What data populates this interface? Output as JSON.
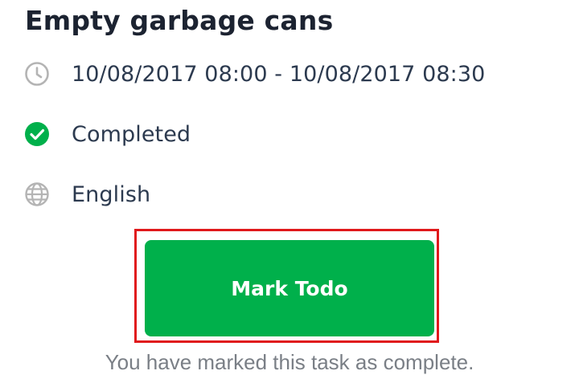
{
  "task": {
    "title": "Empty garbage cans",
    "time_range": "10/08/2017 08:00 - 10/08/2017 08:30",
    "status": "Completed",
    "language": "English"
  },
  "icons": {
    "time": "clock-icon",
    "status": "check-circle-icon",
    "language": "globe-icon"
  },
  "colors": {
    "accent_green": "#00b04b",
    "highlight_red": "#e0191c",
    "icon_grey": "#b4b4b4"
  },
  "action": {
    "button_label": "Mark Todo"
  },
  "footnote": "You have marked this task as complete."
}
